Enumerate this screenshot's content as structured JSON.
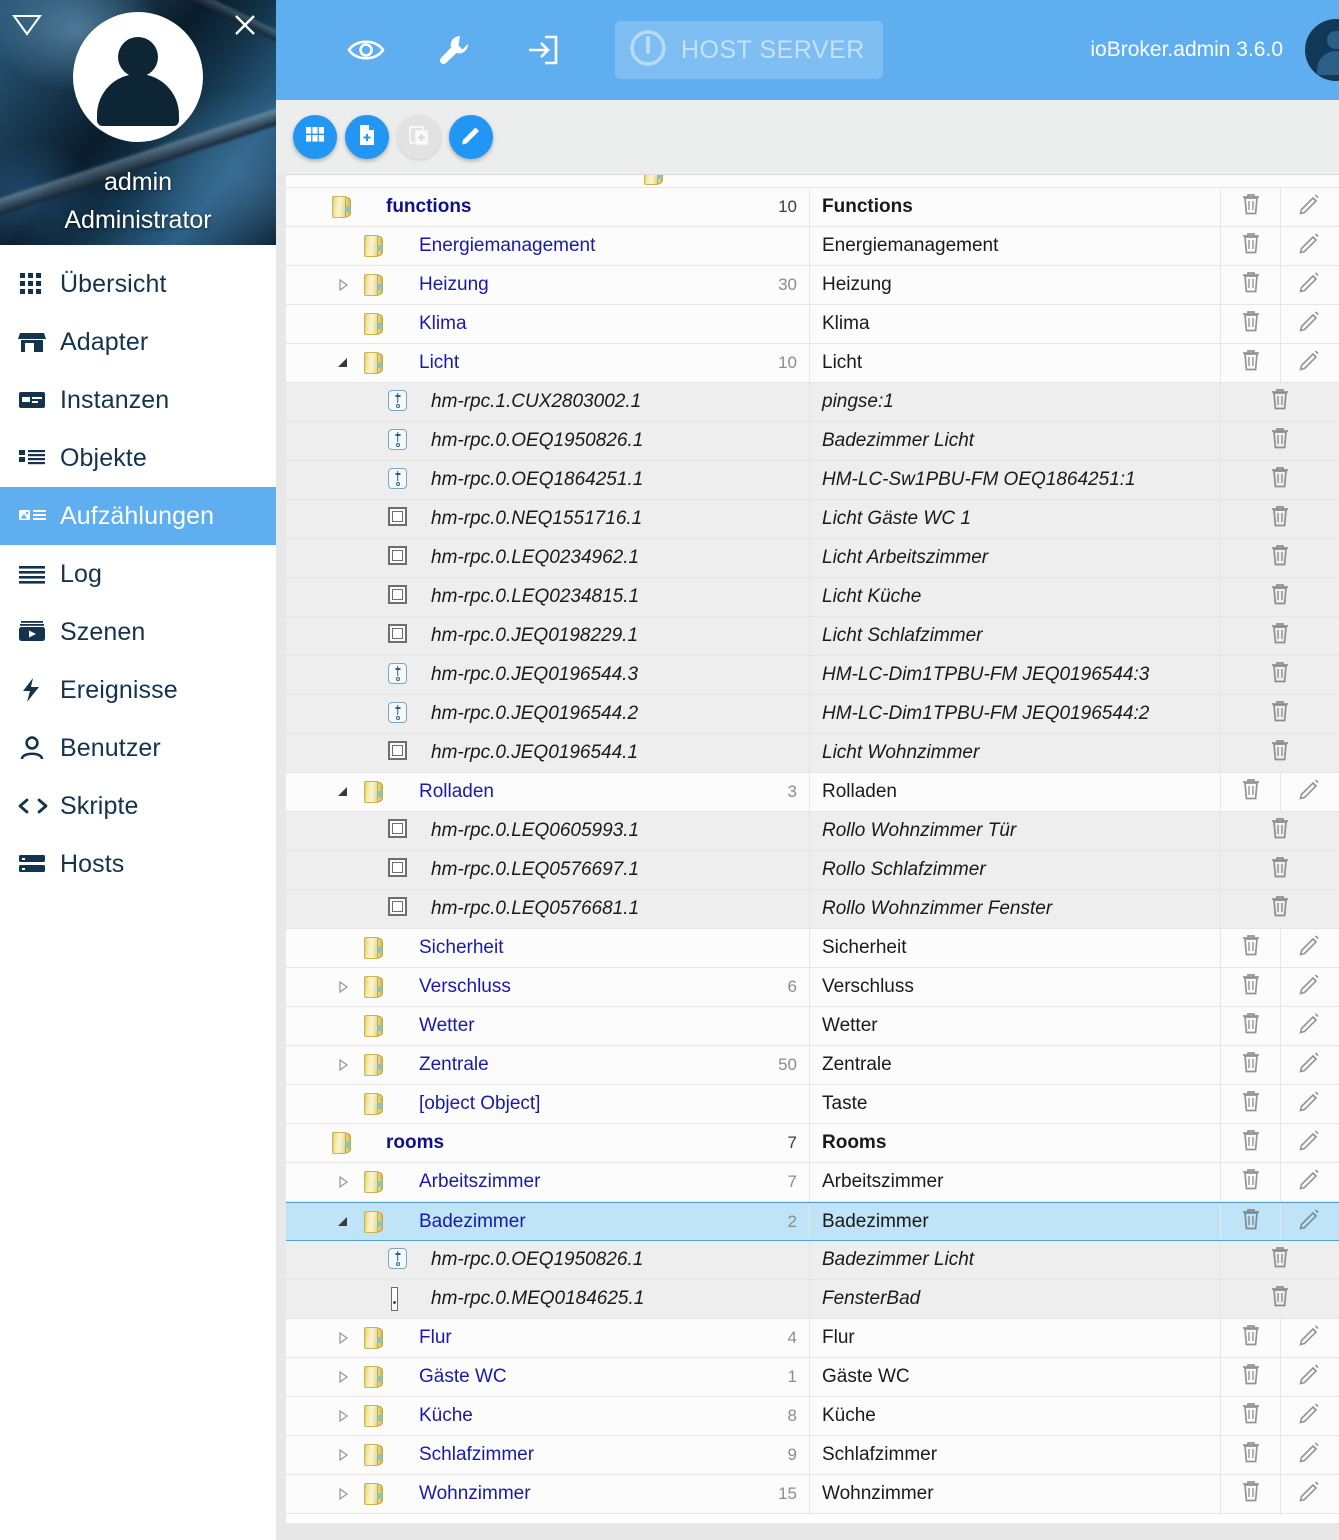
{
  "sidebar": {
    "user": {
      "name": "admin",
      "role": "Administrator"
    },
    "header_icons": {
      "collapse": "triangle-down-icon",
      "close": "close-icon"
    },
    "items": [
      {
        "label": "Übersicht",
        "icon": "apps-grid-icon",
        "selected": false
      },
      {
        "label": "Adapter",
        "icon": "store-icon",
        "selected": false
      },
      {
        "label": "Instanzen",
        "icon": "instances-icon",
        "selected": false
      },
      {
        "label": "Objekte",
        "icon": "list-icon",
        "selected": false
      },
      {
        "label": "Aufzählungen",
        "icon": "enums-icon",
        "selected": true
      },
      {
        "label": "Log",
        "icon": "lines-icon",
        "selected": false
      },
      {
        "label": "Szenen",
        "icon": "play-box-icon",
        "selected": false
      },
      {
        "label": "Ereignisse",
        "icon": "bolt-icon",
        "selected": false
      },
      {
        "label": "Benutzer",
        "icon": "user-icon",
        "selected": false
      },
      {
        "label": "Skripte",
        "icon": "code-icon",
        "selected": false
      },
      {
        "label": "Hosts",
        "icon": "server-icon",
        "selected": false
      }
    ]
  },
  "topbar": {
    "icons": [
      {
        "name": "eye-icon"
      },
      {
        "name": "wrench-icon"
      },
      {
        "name": "login-arrow-icon"
      }
    ],
    "host_button": {
      "label": "HOST SERVER",
      "icon": "power-info-icon"
    },
    "version": "ioBroker.admin 3.6.0",
    "avatar": "user-avatar"
  },
  "toolbar": {
    "buttons": [
      {
        "name": "grid-view-button",
        "icon": "grid-icon",
        "disabled": false
      },
      {
        "name": "new-enum-button",
        "icon": "file-plus-icon",
        "disabled": false
      },
      {
        "name": "duplicate-button",
        "icon": "copy-plus-icon",
        "disabled": true
      },
      {
        "name": "edit-button",
        "icon": "pencil-icon",
        "disabled": false
      }
    ]
  },
  "table": {
    "rows": [
      {
        "level": 0,
        "state": "expanded",
        "icon": "folder",
        "id": "functions",
        "count": "10",
        "name": "Functions",
        "style": "root",
        "edit": true,
        "selected": false,
        "alt": false
      },
      {
        "level": 1,
        "state": "none",
        "icon": "folder",
        "id": "Energiemanagement",
        "count": "",
        "name": "Energiemanagement",
        "style": "folder",
        "edit": true,
        "selected": false,
        "alt": false
      },
      {
        "level": 1,
        "state": "collapsed",
        "icon": "folder",
        "id": "Heizung",
        "count": "30",
        "name": "Heizung",
        "style": "folder",
        "edit": true,
        "selected": false,
        "alt": false
      },
      {
        "level": 1,
        "state": "none",
        "icon": "folder",
        "id": "Klima",
        "count": "",
        "name": "Klima",
        "style": "folder",
        "edit": true,
        "selected": false,
        "alt": false
      },
      {
        "level": 1,
        "state": "expanded",
        "icon": "folder",
        "id": "Licht",
        "count": "10",
        "name": "Licht",
        "style": "folder",
        "edit": true,
        "selected": false,
        "alt": false
      },
      {
        "level": 2,
        "state": "none",
        "icon": "state",
        "id": "hm-rpc.1.CUX2803002.1",
        "count": "",
        "name": "pingse:1",
        "style": "leaf",
        "edit": false,
        "selected": false,
        "alt": true
      },
      {
        "level": 2,
        "state": "none",
        "icon": "state",
        "id": "hm-rpc.0.OEQ1950826.1",
        "count": "",
        "name": "Badezimmer Licht",
        "style": "leaf",
        "edit": false,
        "selected": false,
        "alt": true
      },
      {
        "level": 2,
        "state": "none",
        "icon": "state",
        "id": "hm-rpc.0.OEQ1864251.1",
        "count": "",
        "name": "HM-LC-Sw1PBU-FM OEQ1864251:1",
        "style": "leaf",
        "edit": false,
        "selected": false,
        "alt": true
      },
      {
        "level": 2,
        "state": "none",
        "icon": "channel",
        "id": "hm-rpc.0.NEQ1551716.1",
        "count": "",
        "name": "Licht Gäste WC 1",
        "style": "leaf",
        "edit": false,
        "selected": false,
        "alt": true
      },
      {
        "level": 2,
        "state": "none",
        "icon": "channel",
        "id": "hm-rpc.0.LEQ0234962.1",
        "count": "",
        "name": "Licht Arbeitszimmer",
        "style": "leaf",
        "edit": false,
        "selected": false,
        "alt": true
      },
      {
        "level": 2,
        "state": "none",
        "icon": "channel",
        "id": "hm-rpc.0.LEQ0234815.1",
        "count": "",
        "name": "Licht Küche",
        "style": "leaf",
        "edit": false,
        "selected": false,
        "alt": true
      },
      {
        "level": 2,
        "state": "none",
        "icon": "channel",
        "id": "hm-rpc.0.JEQ0198229.1",
        "count": "",
        "name": "Licht Schlafzimmer",
        "style": "leaf",
        "edit": false,
        "selected": false,
        "alt": true
      },
      {
        "level": 2,
        "state": "none",
        "icon": "state",
        "id": "hm-rpc.0.JEQ0196544.3",
        "count": "",
        "name": "HM-LC-Dim1TPBU-FM JEQ0196544:3",
        "style": "leaf",
        "edit": false,
        "selected": false,
        "alt": true
      },
      {
        "level": 2,
        "state": "none",
        "icon": "state",
        "id": "hm-rpc.0.JEQ0196544.2",
        "count": "",
        "name": "HM-LC-Dim1TPBU-FM JEQ0196544:2",
        "style": "leaf",
        "edit": false,
        "selected": false,
        "alt": true
      },
      {
        "level": 2,
        "state": "none",
        "icon": "channel",
        "id": "hm-rpc.0.JEQ0196544.1",
        "count": "",
        "name": "Licht Wohnzimmer",
        "style": "leaf",
        "edit": false,
        "selected": false,
        "alt": true
      },
      {
        "level": 1,
        "state": "expanded",
        "icon": "folder",
        "id": "Rolladen",
        "count": "3",
        "name": "Rolladen",
        "style": "folder",
        "edit": true,
        "selected": false,
        "alt": false
      },
      {
        "level": 2,
        "state": "none",
        "icon": "channel",
        "id": "hm-rpc.0.LEQ0605993.1",
        "count": "",
        "name": "Rollo Wohnzimmer Tür",
        "style": "leaf",
        "edit": false,
        "selected": false,
        "alt": true
      },
      {
        "level": 2,
        "state": "none",
        "icon": "channel",
        "id": "hm-rpc.0.LEQ0576697.1",
        "count": "",
        "name": "Rollo Schlafzimmer",
        "style": "leaf",
        "edit": false,
        "selected": false,
        "alt": true
      },
      {
        "level": 2,
        "state": "none",
        "icon": "channel",
        "id": "hm-rpc.0.LEQ0576681.1",
        "count": "",
        "name": "Rollo Wohnzimmer Fenster",
        "style": "leaf",
        "edit": false,
        "selected": false,
        "alt": true
      },
      {
        "level": 1,
        "state": "none",
        "icon": "folder",
        "id": "Sicherheit",
        "count": "",
        "name": "Sicherheit",
        "style": "folder",
        "edit": true,
        "selected": false,
        "alt": false
      },
      {
        "level": 1,
        "state": "collapsed",
        "icon": "folder",
        "id": "Verschluss",
        "count": "6",
        "name": "Verschluss",
        "style": "folder",
        "edit": true,
        "selected": false,
        "alt": false
      },
      {
        "level": 1,
        "state": "none",
        "icon": "folder",
        "id": "Wetter",
        "count": "",
        "name": "Wetter",
        "style": "folder",
        "edit": true,
        "selected": false,
        "alt": false
      },
      {
        "level": 1,
        "state": "collapsed",
        "icon": "folder",
        "id": "Zentrale",
        "count": "50",
        "name": "Zentrale",
        "style": "folder",
        "edit": true,
        "selected": false,
        "alt": false
      },
      {
        "level": 1,
        "state": "none",
        "icon": "folder",
        "id": "[object Object]",
        "count": "",
        "name": "Taste",
        "style": "folder",
        "edit": true,
        "selected": false,
        "alt": false
      },
      {
        "level": 0,
        "state": "expanded",
        "icon": "folder",
        "id": "rooms",
        "count": "7",
        "name": "Rooms",
        "style": "root",
        "edit": true,
        "selected": false,
        "alt": false
      },
      {
        "level": 1,
        "state": "collapsed",
        "icon": "folder",
        "id": "Arbeitszimmer",
        "count": "7",
        "name": "Arbeitszimmer",
        "style": "folder",
        "edit": true,
        "selected": false,
        "alt": false
      },
      {
        "level": 1,
        "state": "expanded",
        "icon": "folder",
        "id": "Badezimmer",
        "count": "2",
        "name": "Badezimmer",
        "style": "folder",
        "edit": true,
        "selected": true,
        "alt": false
      },
      {
        "level": 2,
        "state": "none",
        "icon": "state",
        "id": "hm-rpc.0.OEQ1950826.1",
        "count": "",
        "name": "Badezimmer Licht",
        "style": "leaf",
        "edit": false,
        "selected": false,
        "alt": true
      },
      {
        "level": 2,
        "state": "none",
        "icon": "thin",
        "id": "hm-rpc.0.MEQ0184625.1",
        "count": "",
        "name": "FensterBad",
        "style": "leaf",
        "edit": false,
        "selected": false,
        "alt": true
      },
      {
        "level": 1,
        "state": "collapsed",
        "icon": "folder",
        "id": "Flur",
        "count": "4",
        "name": "Flur",
        "style": "folder",
        "edit": true,
        "selected": false,
        "alt": false
      },
      {
        "level": 1,
        "state": "collapsed",
        "icon": "folder",
        "id": "Gäste WC",
        "count": "1",
        "name": "Gäste WC",
        "style": "folder",
        "edit": true,
        "selected": false,
        "alt": false
      },
      {
        "level": 1,
        "state": "collapsed",
        "icon": "folder",
        "id": "Küche",
        "count": "8",
        "name": "Küche",
        "style": "folder",
        "edit": true,
        "selected": false,
        "alt": false
      },
      {
        "level": 1,
        "state": "collapsed",
        "icon": "folder",
        "id": "Schlafzimmer",
        "count": "9",
        "name": "Schlafzimmer",
        "style": "folder",
        "edit": true,
        "selected": false,
        "alt": false
      },
      {
        "level": 1,
        "state": "collapsed",
        "icon": "folder",
        "id": "Wohnzimmer",
        "count": "15",
        "name": "Wohnzimmer",
        "style": "folder",
        "edit": true,
        "selected": false,
        "alt": false
      }
    ]
  },
  "colors": {
    "accent": "#5eaef0",
    "fab": "#2196f3",
    "selected_row": "#bfe3f7",
    "link": "#1a1aa8"
  }
}
